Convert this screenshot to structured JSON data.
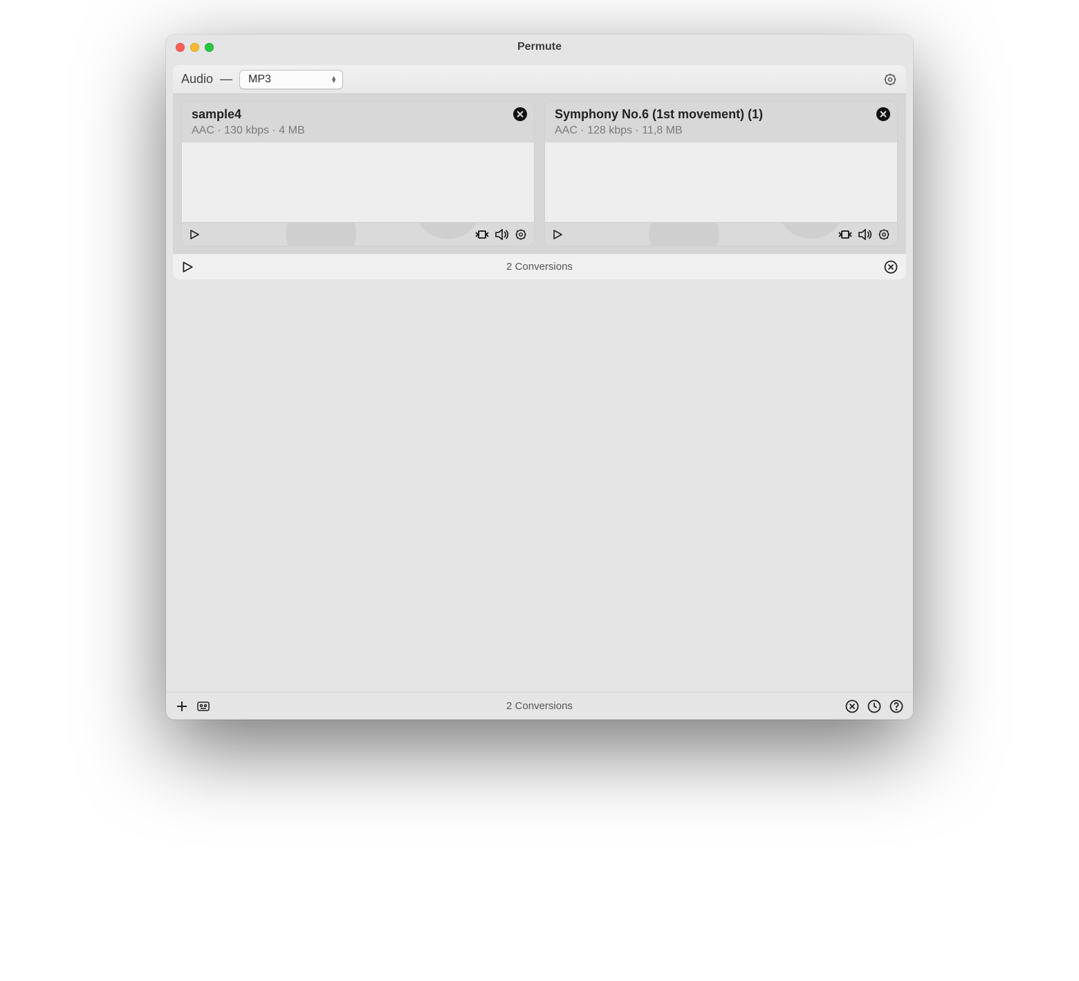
{
  "window": {
    "title": "Permute"
  },
  "panel": {
    "category_label": "Audio",
    "format_selected": "MP3"
  },
  "items": [
    {
      "title": "sample4",
      "meta": "AAC · 130 kbps · 4 MB"
    },
    {
      "title": "Symphony No.6 (1st movement) (1)",
      "meta": "AAC · 128 kbps · 11,8 MB"
    }
  ],
  "panel_footer": {
    "count_label": "2 Conversions"
  },
  "window_footer": {
    "count_label": "2 Conversions"
  }
}
